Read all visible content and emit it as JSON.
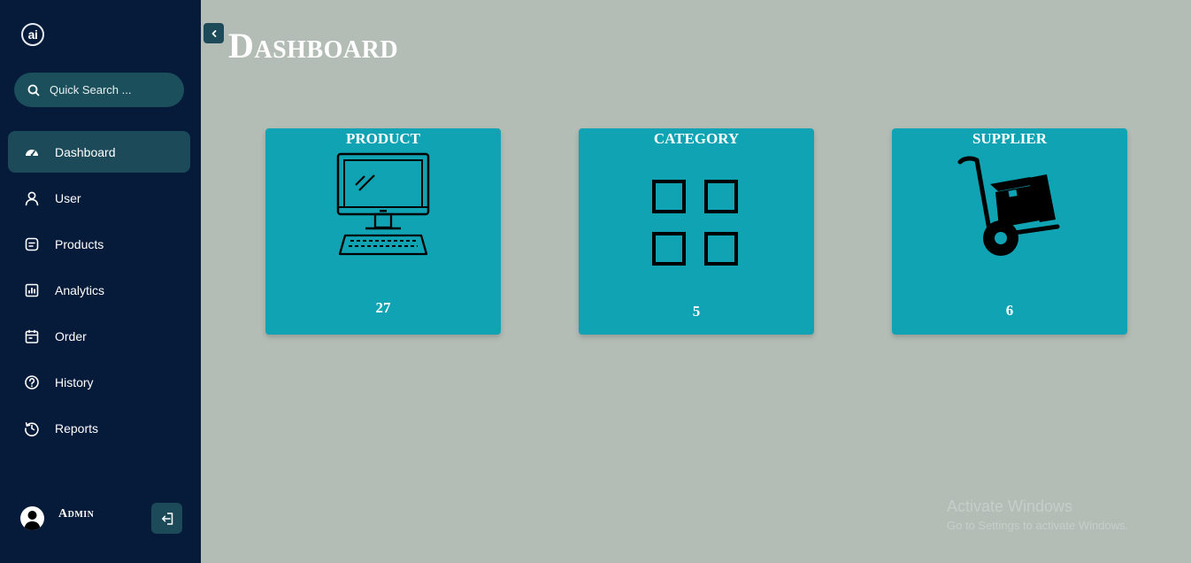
{
  "app": {
    "logo_text": "ai"
  },
  "search": {
    "placeholder": "Quick Search ..."
  },
  "sidebar": {
    "items": [
      {
        "label": "Dashboard",
        "icon": "speedometer-icon",
        "active": true
      },
      {
        "label": "User",
        "icon": "user-icon"
      },
      {
        "label": "Products",
        "icon": "document-icon"
      },
      {
        "label": "Analytics",
        "icon": "bar-chart-icon"
      },
      {
        "label": "Order",
        "icon": "calendar-icon"
      },
      {
        "label": "History",
        "icon": "help-circle-icon"
      },
      {
        "label": "Reports",
        "icon": "history-icon"
      }
    ],
    "user_name": "Admin"
  },
  "page": {
    "title": "Dashboard"
  },
  "cards": [
    {
      "title": "PRODUCT",
      "count": "27",
      "icon": "computer-icon"
    },
    {
      "title": "CATEGORY",
      "count": "5",
      "icon": "grid-icon"
    },
    {
      "title": "SUPPLIER",
      "count": "6",
      "icon": "hand-truck-icon"
    }
  ],
  "watermark": {
    "line1": "Activate Windows",
    "line2": "Go to Settings to activate Windows."
  },
  "colors": {
    "sidebar": "#061a3a",
    "accent": "#1d4a58",
    "card": "#10a3b3",
    "background": "#b3bdb5"
  }
}
